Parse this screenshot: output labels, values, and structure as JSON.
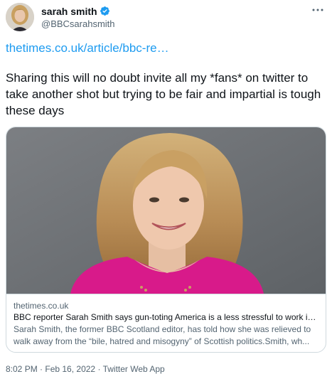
{
  "author": {
    "display_name": "sarah smith",
    "handle": "@BBCsarahsmith"
  },
  "tweet": {
    "link_text": "thetimes.co.uk/article/bbc-re…",
    "text": "Sharing this will no doubt invite all my *fans* on twitter to take another shot but trying to be fair and impartial is tough these days"
  },
  "card": {
    "domain": "thetimes.co.uk",
    "title": "BBC reporter Sarah Smith says gun-toting America is a less stressful to work in...",
    "description": "Sarah Smith, the former BBC Scotland editor, has told how she was relieved to walk away from the “bile, hatred and misogyny” of Scottish politics.Smith, wh..."
  },
  "footer": {
    "time": "8:02 PM",
    "date": "Feb 16, 2022",
    "source": "Twitter Web App",
    "separator": " · "
  },
  "colors": {
    "accent": "#1d9bf0",
    "text": "#0f1419",
    "secondary": "#536471",
    "border": "#cfd9de"
  },
  "icons": {
    "verified": "verified-badge-icon",
    "more": "more-dots-icon"
  }
}
